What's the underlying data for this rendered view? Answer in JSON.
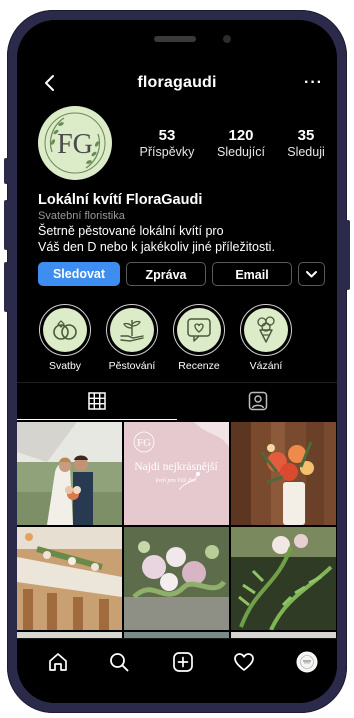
{
  "profile": {
    "username": "floragaudi",
    "avatar_monogram": "FG",
    "stats": [
      {
        "value": "53",
        "label": "Příspěvky"
      },
      {
        "value": "120",
        "label": "Sledující"
      },
      {
        "value": "35",
        "label": "Sleduji"
      }
    ],
    "name": "Lokální kvítí FloraGaudi",
    "category": "Svatební floristika",
    "bio_lines": [
      "Šetrně pěstované lokální kvítí pro",
      "Váš den D nebo k jakékoliv jiné příležitosti."
    ]
  },
  "actions": {
    "follow": "Sledovat",
    "message": "Zpráva",
    "email": "Email"
  },
  "highlights": [
    {
      "label": "Svatby",
      "icon": "rings-icon"
    },
    {
      "label": "Pěstování",
      "icon": "plant-hand-icon"
    },
    {
      "label": "Recenze",
      "icon": "heart-message-icon"
    },
    {
      "label": "Vázání",
      "icon": "bouquet-icon"
    }
  ],
  "tabs": [
    {
      "name": "grid-tab",
      "icon": "grid-icon",
      "active": true
    },
    {
      "name": "tagged-tab",
      "icon": "tagged-person-icon",
      "active": false
    }
  ],
  "posts": [
    {
      "kind": "wedding couple photo"
    },
    {
      "kind": "promo card",
      "monogram": "FG",
      "headline": "Najdi nejkrásnější",
      "sub": "kvítí pro Váš den"
    },
    {
      "kind": "flower arrangement photo"
    },
    {
      "kind": "table decoration photo"
    },
    {
      "kind": "floral centerpiece photo"
    },
    {
      "kind": "greenery bouquet photo"
    }
  ],
  "nav": [
    "home-icon",
    "search-icon",
    "add-post-icon",
    "heart-icon",
    "profile-avatar"
  ],
  "colors": {
    "accent": "#3d8ef0",
    "avatar_bg": "#dcebc8",
    "frame": "#2b2a4a"
  }
}
